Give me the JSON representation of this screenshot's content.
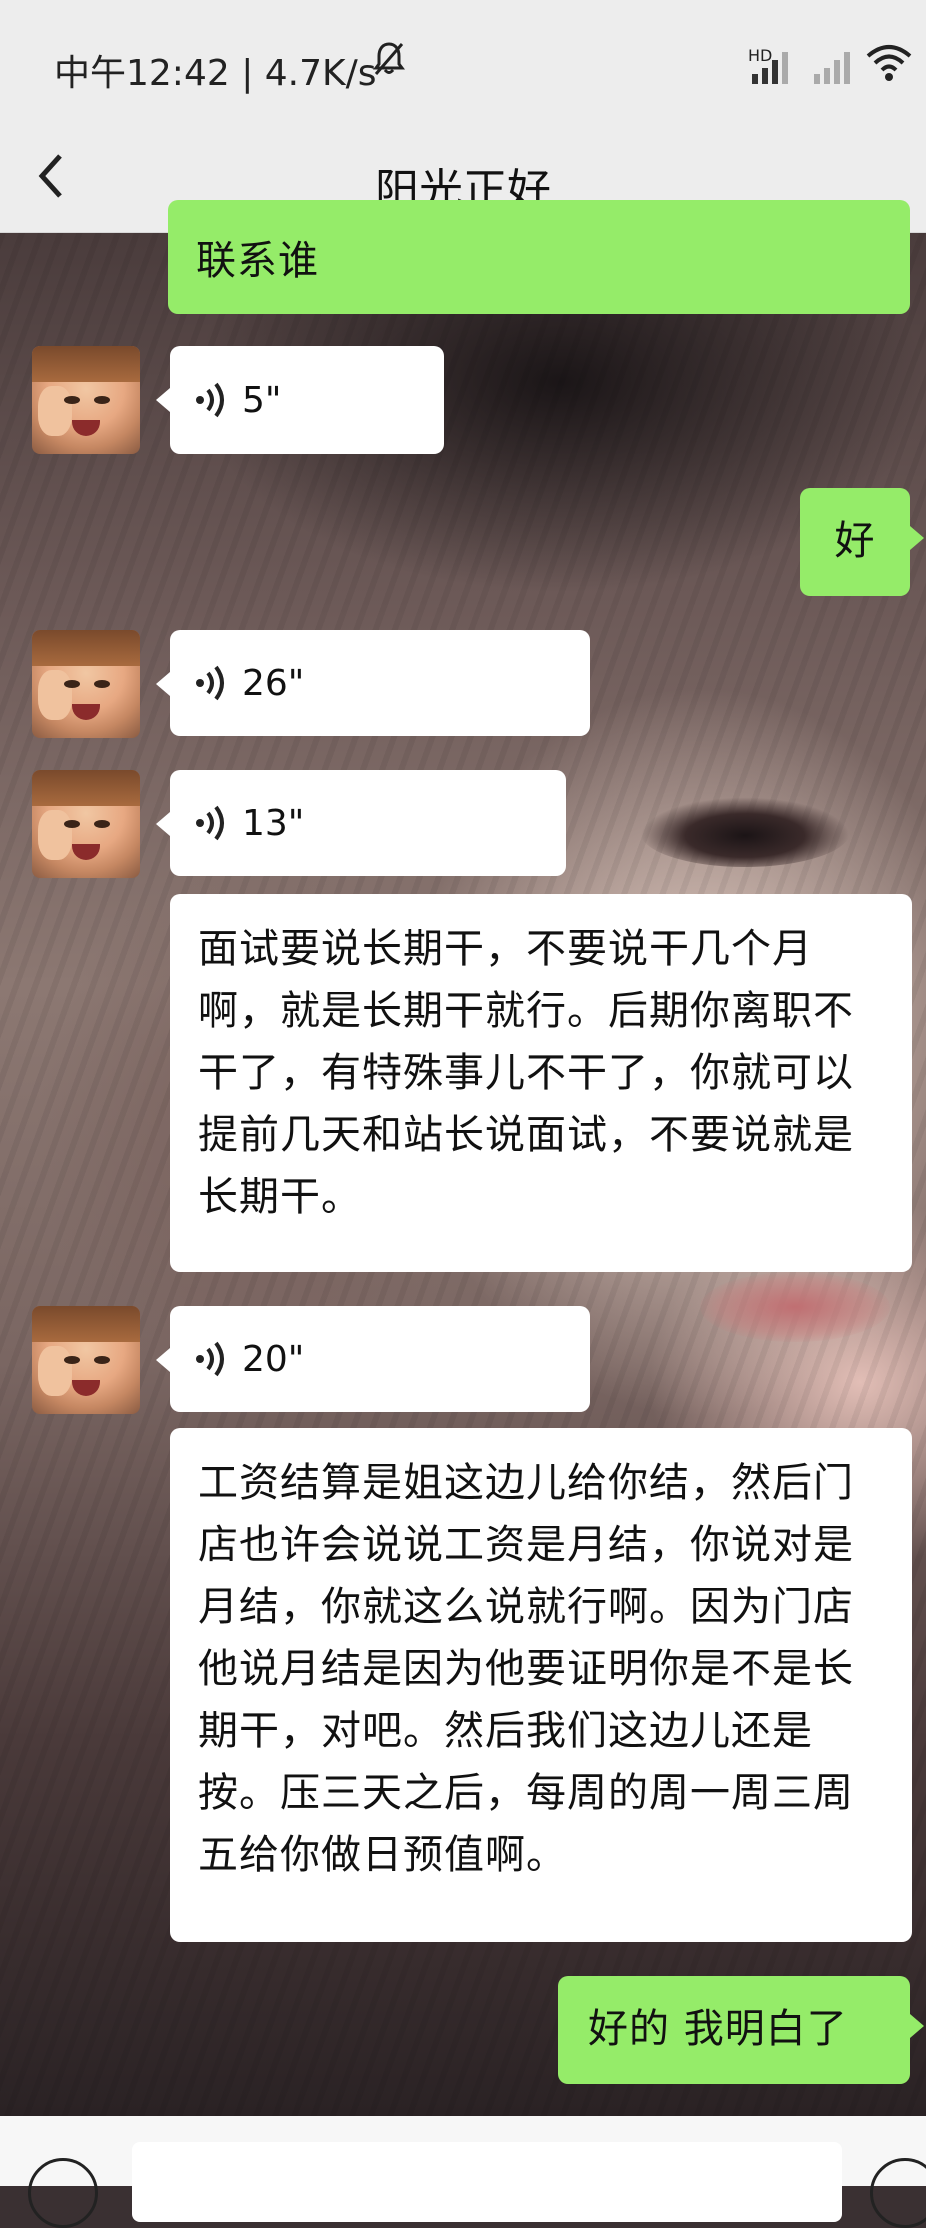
{
  "status_bar": {
    "time": "中午12:42",
    "speed": "| 4.7K/s",
    "hd": "HD"
  },
  "nav": {
    "back_icon": "chevron-left-icon",
    "title": "阳光正好"
  },
  "messages": [
    {
      "side": "right",
      "kind": "text",
      "text": "联系谁"
    },
    {
      "side": "left",
      "kind": "voice",
      "duration": "5\""
    },
    {
      "side": "right",
      "kind": "text",
      "text": "好"
    },
    {
      "side": "left",
      "kind": "voice",
      "duration": "26\""
    },
    {
      "side": "left",
      "kind": "voice",
      "duration": "13\""
    },
    {
      "side": "left",
      "kind": "text",
      "text": "面试要说长期干，不要说干几个月啊，就是长期干就行。后期你离职不干了，有特殊事儿不干了，你就可以提前几天和站长说面试，不要说就是长期干。"
    },
    {
      "side": "left",
      "kind": "voice",
      "duration": "20\""
    },
    {
      "side": "left",
      "kind": "text",
      "text": "工资结算是姐这边儿给你结，然后门店也许会说说工资是月结，你说对是月结，你就这么说就行啊。因为门店他说月结是因为他要证明你是不是长期干，对吧。然后我们这边儿还是按。压三天之后，每周的周一周三周五给你做日预值啊。"
    },
    {
      "side": "right",
      "kind": "text",
      "text": "好的 我明白了"
    }
  ],
  "input_bar": {
    "voice_icon": "voice-input-icon",
    "emoji_icon": "emoji-icon"
  },
  "colors": {
    "sent_bubble": "#95ec69",
    "received_bubble": "#ffffff",
    "header_bg": "#ededed"
  }
}
